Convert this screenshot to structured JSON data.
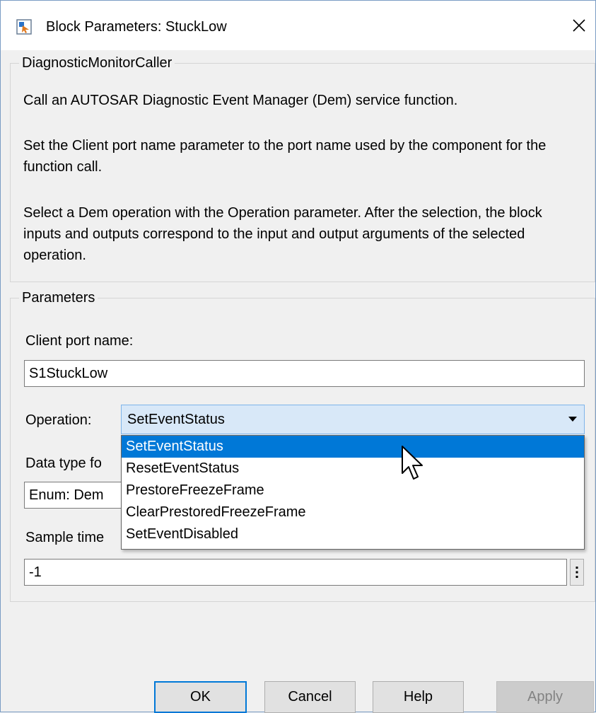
{
  "window": {
    "title": "Block Parameters: StuckLow"
  },
  "description": {
    "group_label": "DiagnosticMonitorCaller",
    "paragraph1": "Call an AUTOSAR Diagnostic Event Manager (Dem) service function.",
    "paragraph2": "Set the Client port name parameter to the port name used by the component for the function call.",
    "paragraph3": "Select a Dem operation with the Operation parameter.  After the selection, the block inputs and outputs correspond to the input and output arguments of the selected operation."
  },
  "parameters": {
    "group_label": "Parameters",
    "client_port_label": "Client port name:",
    "client_port_value": "S1StuckLow",
    "operation_label": "Operation:",
    "operation_value": "SetEventStatus",
    "operation_options": [
      "SetEventStatus",
      "ResetEventStatus",
      "PrestoreFreezeFrame",
      "ClearPrestoredFreezeFrame",
      "SetEventDisabled"
    ],
    "data_type_label": "Data type fo",
    "data_type_value": "Enum: Dem",
    "sample_time_label": "Sample time",
    "sample_time_value": "-1"
  },
  "buttons": {
    "ok": "OK",
    "cancel": "Cancel",
    "help": "Help",
    "apply": "Apply"
  },
  "colors": {
    "accent": "#0078d7",
    "combo_background": "#d8e8f8",
    "window_background": "#f0f0f0"
  },
  "icons": {
    "app": "block-parameters-icon",
    "close": "close-icon",
    "more": "vertical-ellipsis-icon",
    "dropdown": "chevron-down-icon",
    "cursor": "mouse-pointer-icon"
  }
}
